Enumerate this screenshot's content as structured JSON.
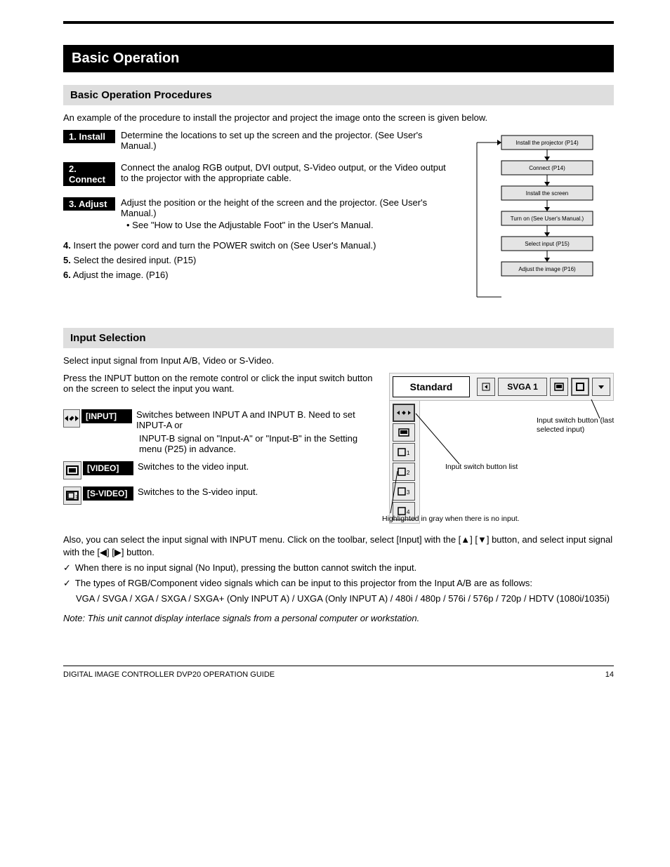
{
  "title": "Basic Operation",
  "sections": {
    "basic_procedures": {
      "heading": "Basic Operation Procedures",
      "intro": "An example of the procedure to install the projector and project the image onto the screen is given below.",
      "steps": [
        {
          "label": "1. Install",
          "text": "Determine the locations to set up the screen and the projector. (See User's Manual.)"
        },
        {
          "label": "2. Connect",
          "text": "Connect the analog RGB output, DVI output, S-Video output, or the Video output to the projector with the appropriate cable."
        },
        {
          "label": "3. Adjust",
          "text": "Adjust the position or the height of the screen and the projector. (See User's Manual.)",
          "sub": "• See \"How to Use the Adjustable Foot\" in the User's Manual."
        }
      ],
      "rest": [
        {
          "n": "4.",
          "text": "Insert the power cord and turn the POWER switch on (See User's Manual.)"
        },
        {
          "n": "5.",
          "text": "Select the desired input. (P15)"
        },
        {
          "n": "6.",
          "text": "Adjust the image. (P16)"
        }
      ],
      "flow_boxes": [
        "Install the projector (P14)",
        "Connect (P14)",
        "Install the screen",
        "Turn on (See User's Manual.)",
        "Select input (P15)",
        "Adjust the image (P16)"
      ]
    },
    "input_selection": {
      "heading": "Input Selection",
      "intro1": "Select input signal from Input A/B, Video or S-Video.",
      "intro2": "Press the INPUT button on the remote control or click the input switch button on the screen to select the input you want.",
      "icons": [
        {
          "name": "arrows-icon",
          "badge": "[INPUT]",
          "text": "Switches between INPUT A and INPUT B. Need to set INPUT-A or",
          "sub": "INPUT-B signal on \"Input-A\" or \"Input-B\" in the Setting menu (P25) in advance."
        },
        {
          "name": "video-icon",
          "badge": "[VIDEO]",
          "text": "Switches to the video input."
        },
        {
          "name": "svideo-icon",
          "badge": "[S-VIDEO]",
          "text": "Switches to the S-video input."
        }
      ],
      "toolbar": {
        "standard": "Standard",
        "svga": "SVGA 1"
      },
      "callouts": {
        "list": "Input switch button list",
        "btn": "Input switch button (last selected input)",
        "disabled": "Highlighted in gray when there is no input."
      },
      "para": "Also, you can select the input signal with INPUT menu. Click on the toolbar, select [Input] with the [▲] [▼] button, and select input signal with the [◀] [▶] button.",
      "check1": "When there is no input signal (No Input), pressing the button cannot switch the input.",
      "check2": "The types of RGB/Component video signals which can be input to this projector from the Input A/B are as follows:",
      "types": "VGA / SVGA / XGA / SXGA / SXGA+ (Only INPUT A) / UXGA (Only INPUT A) / 480i / 480p / 576i / 576p / 720p / HDTV (1080i/1035i)",
      "note": "Note: This unit cannot display interlace signals from a personal computer or workstation."
    }
  },
  "footer": {
    "left": "DIGITAL IMAGE CONTROLLER DVP20 OPERATION GUIDE",
    "right": "14"
  }
}
